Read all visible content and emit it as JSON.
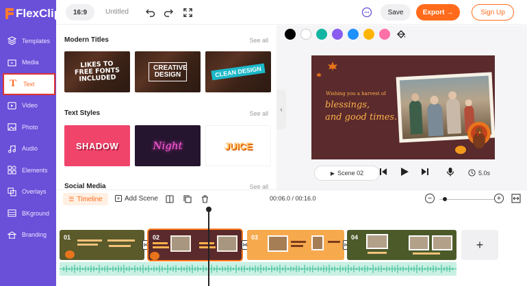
{
  "app": {
    "name": "FlexClip"
  },
  "sidebar": {
    "items": [
      {
        "label": "Templates",
        "icon": "layers-icon"
      },
      {
        "label": "Media",
        "icon": "media-folder-icon"
      },
      {
        "label": "Text",
        "icon": "text-t-icon",
        "active": true
      },
      {
        "label": "Video",
        "icon": "video-icon"
      },
      {
        "label": "Photo",
        "icon": "photo-icon"
      },
      {
        "label": "Audio",
        "icon": "music-note-icon"
      },
      {
        "label": "Elements",
        "icon": "elements-icon"
      },
      {
        "label": "Overlays",
        "icon": "overlays-icon"
      },
      {
        "label": "BKground",
        "icon": "background-icon"
      },
      {
        "label": "Branding",
        "icon": "branding-icon"
      }
    ]
  },
  "topbar": {
    "ratio": "16:9",
    "title": "Untitled",
    "save_label": "Save",
    "export_label": "Export →",
    "signup_label": "Sign Up"
  },
  "panel": {
    "modern_titles": {
      "heading": "Modern Titles",
      "see_all": "See all",
      "items": [
        {
          "text": "LIKES TO FREE FONTS INCLUDED"
        },
        {
          "text": "CREATIVE DESIGN"
        },
        {
          "text": "CLEAN DESIGN"
        }
      ]
    },
    "text_styles": {
      "heading": "Text Styles",
      "see_all": "See all",
      "items": [
        {
          "text": "SHADOW"
        },
        {
          "text": "Night"
        },
        {
          "text": "JUICE"
        }
      ]
    },
    "social_media": {
      "heading": "Social Media",
      "see_all": "See all"
    }
  },
  "editor": {
    "colors": [
      "#000000",
      "#ffffff",
      "#13b5a2",
      "#8a5cf0",
      "#1e90ff",
      "#ffb400",
      "#ff6fa8"
    ],
    "canvas": {
      "line1": "Wishing you a harvest of",
      "line2": "blessings,",
      "line3": "and good times."
    },
    "scene_label": "Scene 02",
    "duration": "5.0s"
  },
  "timeline": {
    "tab_label": "Timeline",
    "add_scene_label": "Add Scene",
    "time": "00:06.0 / 00:16.0",
    "clips": [
      {
        "num": "01"
      },
      {
        "num": "02"
      },
      {
        "num": "03"
      },
      {
        "num": "04"
      }
    ],
    "add_label": "+"
  }
}
